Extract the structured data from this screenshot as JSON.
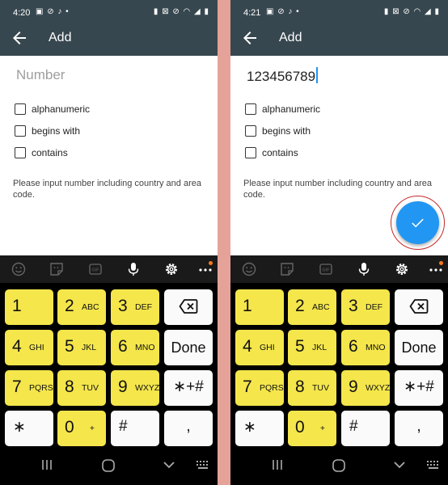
{
  "left": {
    "status": {
      "time": "4:20",
      "left_icons": "▣ ⊘ ♪ •",
      "right_icons": "▮ ⊠ ⊘ ◠ ◢ ▮"
    },
    "appbar": {
      "title": "Add"
    },
    "input": {
      "value": "",
      "placeholder": "Number"
    },
    "options": [
      "alphanumeric",
      "begins with",
      "contains"
    ],
    "help": "Please input number including country and area code."
  },
  "right": {
    "status": {
      "time": "4:21",
      "left_icons": "▣ ⊘ ♪ •",
      "right_icons": "▮ ⊠ ⊘ ◠ ◢ ▮"
    },
    "appbar": {
      "title": "Add"
    },
    "input": {
      "value": "123456789",
      "placeholder": "Number"
    },
    "options": [
      "alphanumeric",
      "begins with",
      "contains"
    ],
    "help": "Please input number including country and area code."
  },
  "keypad": {
    "keys": [
      {
        "digit": "1",
        "letters": ""
      },
      {
        "digit": "2",
        "letters": "ABC"
      },
      {
        "digit": "3",
        "letters": "DEF"
      },
      {
        "digit": "4",
        "letters": "GHI"
      },
      {
        "digit": "5",
        "letters": "JKL"
      },
      {
        "digit": "6",
        "letters": "MNO"
      },
      {
        "digit": "7",
        "letters": "PQRS"
      },
      {
        "digit": "8",
        "letters": "TUV"
      },
      {
        "digit": "9",
        "letters": "WXYZ"
      },
      {
        "digit": "0",
        "letters": "+"
      }
    ],
    "done_left": "Done",
    "done_right": "Done",
    "star": "∗",
    "star_pound": "∗+#",
    "pound": "#",
    "comma": ","
  },
  "colors": {
    "appbar": "#37474f",
    "fab": "#2196f3",
    "key_yellow": "#f4e64b",
    "key_white": "#fafafa",
    "divider": "#e5a298"
  }
}
